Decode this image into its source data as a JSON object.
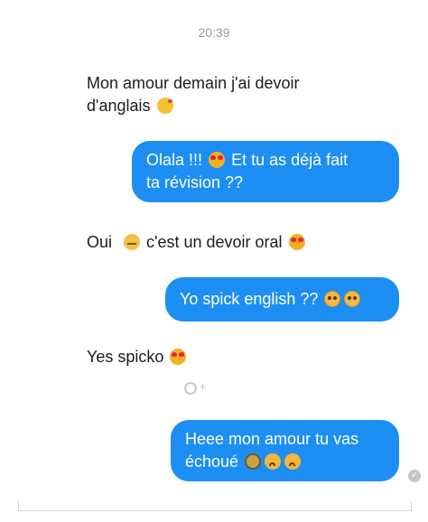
{
  "timestamp": "20:39",
  "messages": [
    {
      "direction": "incoming",
      "line1": "Mon amour demain j'ai devoir",
      "line2": "d'anglais",
      "emoji": "kiss-icon"
    },
    {
      "direction": "outgoing",
      "line1_a": "Olala !!!",
      "line1_b": "Et tu as déjà fait",
      "line2": "ta révision ??",
      "emoji": "heart-eyes-icon"
    },
    {
      "direction": "incoming",
      "part_a": "Oui",
      "part_b": "c'est un devoir oral",
      "emojis": [
        "sweat-smile-icon",
        "heart-eyes-icon"
      ]
    },
    {
      "direction": "outgoing",
      "text": "Yo spick english ??",
      "emojis": [
        "flushed-icon",
        "flushed-icon"
      ]
    },
    {
      "direction": "incoming",
      "text": "Yes spicko",
      "emoji": "heart-eyes-icon"
    },
    {
      "direction": "outgoing",
      "line1": "Heee mon amour tu vas",
      "line2": "échoué",
      "emojis": [
        "old-man-icon",
        "worried-icon",
        "worried-icon"
      ]
    }
  ],
  "colors": {
    "outgoing_bubble": "#1d8ef3",
    "text": "#1c1c1c",
    "timestamp": "#9a9a9a"
  }
}
